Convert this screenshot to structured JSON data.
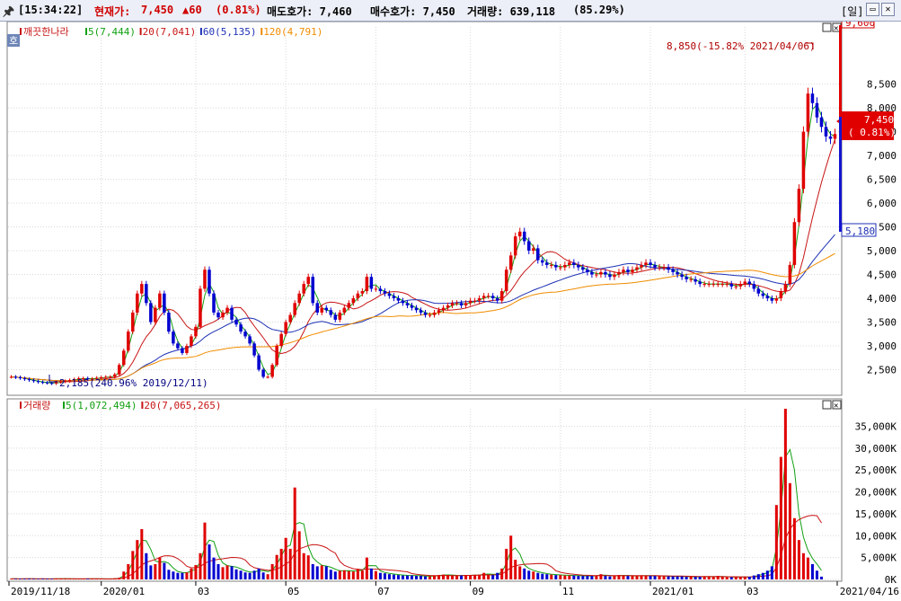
{
  "header": {
    "menu_icon": "pin-icon",
    "time": "[15:34:22]",
    "price_label": "현재가:",
    "price_value": "7,450",
    "change_value": "▲60",
    "change_pct": "(0.81%)",
    "ask_text": "매도호가: 7,460",
    "bid_text": "매수호가: 7,450",
    "volume_text": "거래량: 639,118",
    "volume_pct": "(85.29%)",
    "period_button": "[일]"
  },
  "price_panel": {
    "name": "깨끗한나라",
    "ma_legends": [
      {
        "label": "5(7,444)",
        "color": "#12a012"
      },
      {
        "label": "20(7,041)",
        "color": "#c81414"
      },
      {
        "label": "60(5,135)",
        "color": "#1e32b4"
      },
      {
        "label": "120(4,791)",
        "color": "#f08c00"
      }
    ],
    "corner_tag": "호",
    "y_ticks": [
      "8,500",
      "8,000",
      "7,500",
      "7,000",
      "6,500",
      "6,000",
      "5,500",
      "5,000",
      "4,500",
      "4,000",
      "3,500",
      "3,000",
      "2,500"
    ],
    "max_annotation": "8,850(-15.82% 2021/04/06)",
    "min_annotation": "2,185(240.96% 2019/12/11)",
    "top_price_box": "9,600",
    "current_price_box": "7,450",
    "current_pct_box": "( 0.81%)",
    "low_price_box": "5,180"
  },
  "volume_panel": {
    "title": "거래량",
    "ma_legends": [
      {
        "label": "5(1,072,494)",
        "color": "#12a012"
      },
      {
        "label": "20(7,065,265)",
        "color": "#c81414"
      }
    ],
    "y_ticks": [
      "35,000K",
      "30,000K",
      "25,000K",
      "20,000K",
      "15,000K",
      "10,000K",
      "5,000K",
      "0K"
    ]
  },
  "x_axis": {
    "labels": [
      "2019/11/18",
      "2020/01",
      "03",
      "05",
      "07",
      "09",
      "11",
      "2021/01",
      "03",
      "2021/04/16"
    ]
  },
  "colors": {
    "up": "#e00000",
    "down": "#0000d0",
    "ma5": "#12a012",
    "ma20": "#c81414",
    "ma60": "#1e32b4",
    "ma120": "#f08c00"
  },
  "chart_data": {
    "type": "candlestick",
    "price_ylim": [
      2000,
      9700
    ],
    "volume_ylim": [
      0,
      39000
    ],
    "close_series": [
      2350,
      2340,
      2320,
      2300,
      2280,
      2260,
      2240,
      2230,
      2220,
      2210,
      2240,
      2250,
      2260,
      2280,
      2300,
      2320,
      2320,
      2300,
      2310,
      2330,
      2340,
      2350,
      2350,
      2400,
      2600,
      2900,
      3300,
      3700,
      4100,
      4300,
      3900,
      3500,
      3800,
      4100,
      3700,
      3300,
      3050,
      2950,
      2850,
      3000,
      3200,
      3400,
      4200,
      4600,
      4100,
      3700,
      3600,
      3700,
      3800,
      3550,
      3450,
      3300,
      3200,
      3050,
      2800,
      2500,
      2350,
      2350,
      2600,
      3000,
      3250,
      3500,
      3650,
      3900,
      4100,
      4300,
      4450,
      3900,
      3700,
      3800,
      3750,
      3650,
      3550,
      3700,
      3800,
      3900,
      4000,
      4100,
      4150,
      4450,
      4200,
      4200,
      4150,
      4100,
      4050,
      4000,
      3950,
      3900,
      3850,
      3800,
      3750,
      3700,
      3650,
      3650,
      3700,
      3750,
      3800,
      3850,
      3900,
      3900,
      3850,
      3900,
      3950,
      3950,
      4000,
      4050,
      4050,
      4000,
      3950,
      4150,
      4600,
      4900,
      5300,
      5400,
      5200,
      5000,
      5050,
      4800,
      4750,
      4700,
      4700,
      4650,
      4650,
      4700,
      4750,
      4700,
      4650,
      4600,
      4550,
      4500,
      4500,
      4550,
      4500,
      4450,
      4500,
      4550,
      4600,
      4550,
      4600,
      4650,
      4700,
      4750,
      4700,
      4650,
      4650,
      4650,
      4600,
      4550,
      4500,
      4450,
      4400,
      4400,
      4350,
      4300,
      4300,
      4300,
      4300,
      4300,
      4300,
      4300,
      4250,
      4250,
      4300,
      4350,
      4300,
      4200,
      4100,
      4050,
      4000,
      3950,
      4000,
      4150,
      4300,
      4700,
      5600,
      6300,
      7500,
      8300,
      8100,
      7800,
      7600,
      7400,
      7350,
      7450
    ],
    "volume_series": [
      150,
      120,
      130,
      140,
      160,
      120,
      110,
      140,
      130,
      120,
      180,
      200,
      150,
      120,
      100,
      110,
      120,
      140,
      160,
      130,
      120,
      110,
      160,
      250,
      400,
      1800,
      3500,
      6500,
      9000,
      11500,
      6000,
      3200,
      3500,
      5000,
      3800,
      2200,
      1800,
      1500,
      1500,
      1600,
      2500,
      3300,
      6000,
      13000,
      8000,
      5000,
      3500,
      2800,
      3200,
      3000,
      2300,
      2000,
      1600,
      1500,
      2000,
      2500,
      1600,
      1200,
      3500,
      5600,
      7000,
      9500,
      7000,
      21000,
      11000,
      6000,
      5500,
      3500,
      3000,
      3200,
      3000,
      2200,
      1800,
      2000,
      2100,
      1900,
      1800,
      2400,
      2000,
      5000,
      2500,
      1900,
      1500,
      1400,
      1200,
      1100,
      1000,
      900,
      900,
      900,
      800,
      800,
      700,
      700,
      900,
      1000,
      1100,
      1000,
      900,
      900,
      900,
      1000,
      900,
      1000,
      1100,
      1500,
      1100,
      1000,
      1500,
      2500,
      7000,
      10000,
      4500,
      3000,
      2500,
      2000,
      1800,
      1500,
      1300,
      1200,
      1100,
      1000,
      1000,
      900,
      900,
      900,
      800,
      800,
      800,
      800,
      900,
      1200,
      800,
      700,
      900,
      1000,
      900,
      800,
      800,
      800,
      900,
      900,
      800,
      800,
      800,
      700,
      700,
      700,
      700,
      700,
      600,
      600,
      600,
      600,
      700,
      600,
      600,
      800,
      600,
      500,
      500,
      600,
      500,
      500,
      600,
      900,
      1200,
      1500,
      2000,
      3000,
      17000,
      28000,
      39000,
      22000,
      14000,
      9000,
      6000,
      5000,
      3500,
      2000,
      639
    ]
  }
}
